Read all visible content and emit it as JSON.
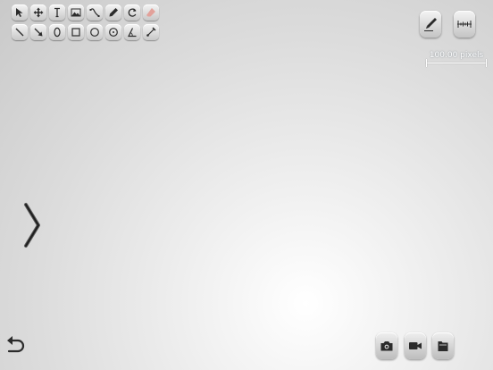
{
  "toolbar": {
    "row1": [
      {
        "name": "select-arrow-icon"
      },
      {
        "name": "move-icon"
      },
      {
        "name": "text-tool-icon"
      },
      {
        "name": "image-icon"
      },
      {
        "name": "curve-tool-icon"
      },
      {
        "name": "pencil-tool-icon"
      },
      {
        "name": "rotate-icon"
      },
      {
        "name": "eraser-icon",
        "disabled": true
      }
    ],
    "row2": [
      {
        "name": "line-tool-icon"
      },
      {
        "name": "arrow-tool-icon"
      },
      {
        "name": "ellipse-tool-icon"
      },
      {
        "name": "rectangle-tool-icon"
      },
      {
        "name": "circle-tool-icon"
      },
      {
        "name": "circle-point-tool-icon"
      },
      {
        "name": "angle-tool-icon"
      },
      {
        "name": "measure-tool-icon"
      }
    ]
  },
  "top_right": {
    "pen_icon": "pen-icon",
    "ruler_icon": "ruler-icon",
    "scale_label": "100.00 pixels"
  },
  "bottom": {
    "camera_icon": "camera-icon",
    "video_icon": "video-camera-icon",
    "folder_icon": "folder-icon",
    "undo_icon": "undo-icon"
  },
  "colors": {
    "icon": "#2b2b2b",
    "disabled_icon": "#e2a19a",
    "scale_text": "#ffffff"
  }
}
